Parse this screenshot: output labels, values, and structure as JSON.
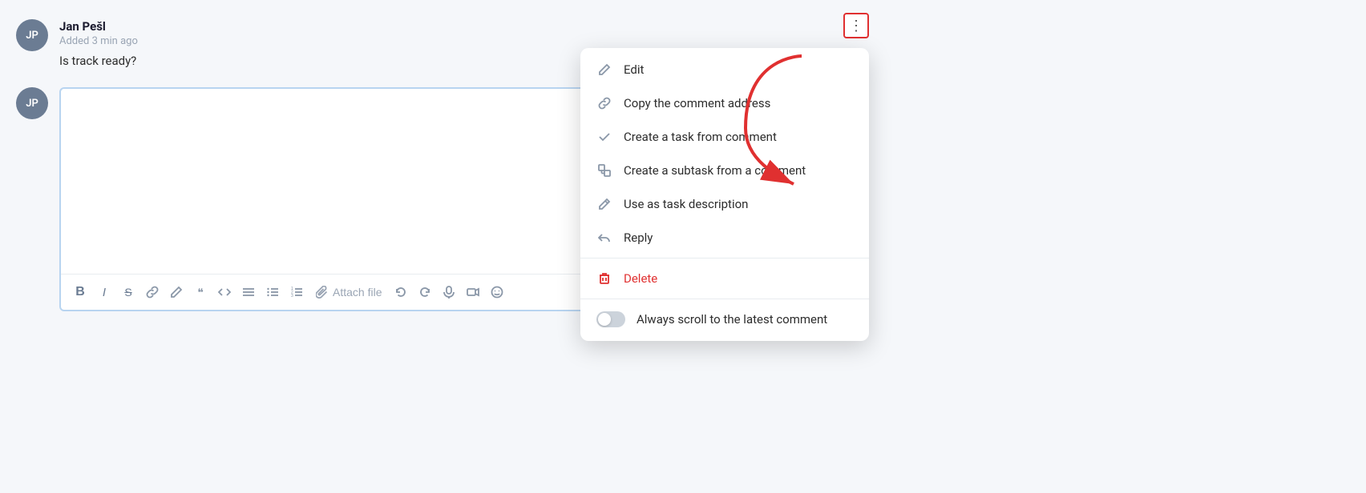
{
  "comment": {
    "author": "Jan Pešl",
    "meta": "Added 3 min ago",
    "text": "Is track ready?",
    "avatar_initials": "JP"
  },
  "reply": {
    "avatar_initials": "JP"
  },
  "toolbar": {
    "bold": "B",
    "italic": "I",
    "strikethrough": "S",
    "link": "🔗",
    "attach_file_label": "Attach file"
  },
  "three_dot_button_label": "⋮",
  "dropdown": {
    "items": [
      {
        "id": "edit",
        "label": "Edit",
        "icon": "pencil"
      },
      {
        "id": "copy-address",
        "label": "Copy the comment address",
        "icon": "link"
      },
      {
        "id": "create-task",
        "label": "Create a task from comment",
        "icon": "check"
      },
      {
        "id": "create-subtask",
        "label": "Create a subtask from a comment",
        "icon": "subtask"
      },
      {
        "id": "use-description",
        "label": "Use as task description",
        "icon": "pencil2"
      },
      {
        "id": "reply",
        "label": "Reply",
        "icon": "reply"
      }
    ],
    "divider_after": 5,
    "delete_label": "Delete",
    "toggle_label": "Always scroll to the latest comment"
  },
  "colors": {
    "avatar_bg": "#6b7c93",
    "accent_blue": "#b8d4f0",
    "delete_red": "#e03030",
    "border_highlight": "#e03030"
  }
}
